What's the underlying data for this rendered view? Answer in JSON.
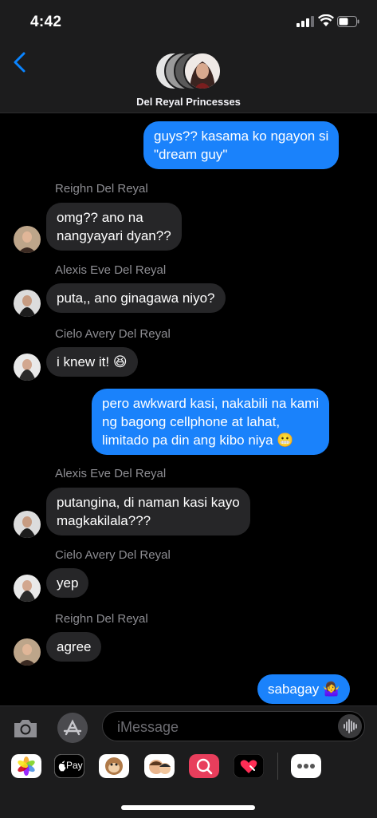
{
  "status": {
    "time": "4:42"
  },
  "header": {
    "group_name": "Del Reyal Princesses"
  },
  "messages": [
    {
      "sender": "",
      "text_lines": [
        "guys?? kasama ko ngayon si",
        "\"dream guy\""
      ],
      "outgoing": true
    },
    {
      "sender": "Reighn Del Reyal",
      "text_lines": [
        "omg?? ano na",
        "nangyayari dyan??"
      ],
      "outgoing": false
    },
    {
      "sender": "Alexis Eve Del Reyal",
      "text_lines": [
        "puta,, ano ginagawa niyo?"
      ],
      "outgoing": false
    },
    {
      "sender": "Cielo Avery Del Reyal",
      "text_lines": [
        "i knew it! 😆"
      ],
      "outgoing": false
    },
    {
      "sender": "",
      "text_lines": [
        "pero awkward kasi, nakabili na kami",
        "ng bagong cellphone at lahat,",
        "limitado pa din ang kibo niya 😬"
      ],
      "outgoing": true
    },
    {
      "sender": "Alexis Eve Del Reyal",
      "text_lines": [
        "putangina, di naman kasi kayo",
        "magkakilala???"
      ],
      "outgoing": false
    },
    {
      "sender": "Cielo Avery Del Reyal",
      "text_lines": [
        "yep"
      ],
      "outgoing": false
    },
    {
      "sender": "Reighn Del Reyal",
      "text_lines": [
        "agree"
      ],
      "outgoing": false
    },
    {
      "sender": "",
      "text_lines": [
        "sabagay 🤷‍♀️"
      ],
      "outgoing": true
    }
  ],
  "composer": {
    "placeholder": "iMessage"
  },
  "apps": {
    "applepay_label": "Pay"
  },
  "colors": {
    "outgoing_bubble": "#1a82fb",
    "incoming_bubble": "#262628",
    "accent": "#0a84ff"
  }
}
